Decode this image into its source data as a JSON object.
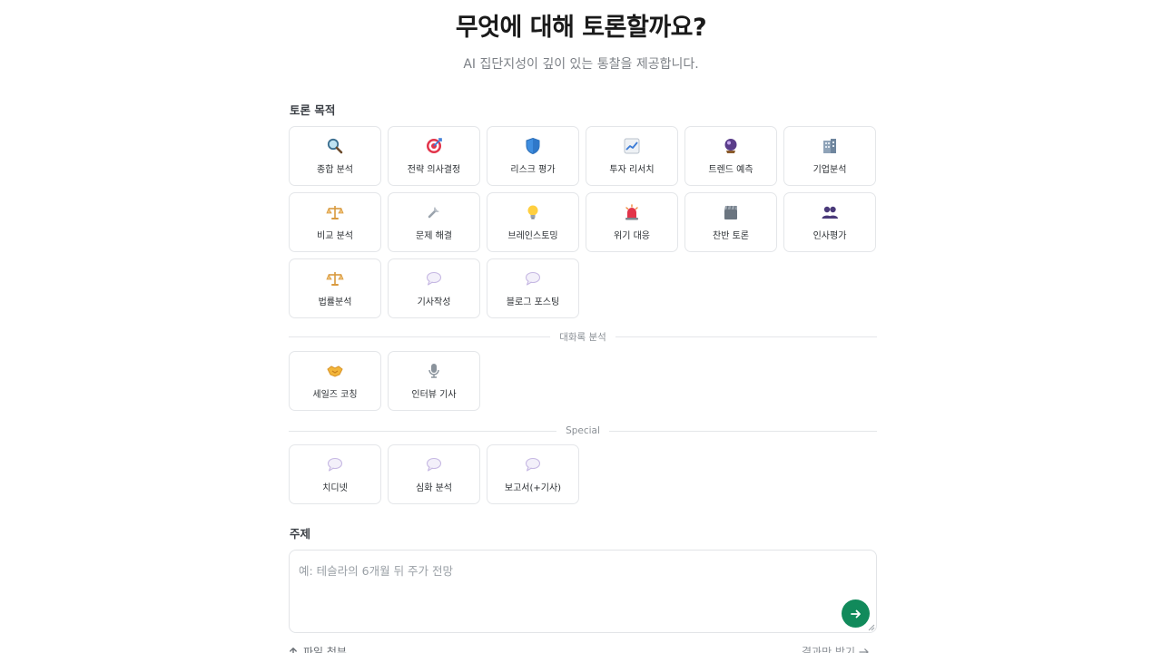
{
  "header": {
    "title": "무엇에 대해 토론할까요?",
    "subtitle": "AI 집단지성이 깊이 있는 통찰을 제공합니다."
  },
  "purpose_section": {
    "label": "토론 목적",
    "items": [
      {
        "label": "종합 분석",
        "icon": "magnifier-icon"
      },
      {
        "label": "전략 의사결정",
        "icon": "target-icon"
      },
      {
        "label": "리스크 평가",
        "icon": "shield-icon"
      },
      {
        "label": "투자 리서치",
        "icon": "chart-icon"
      },
      {
        "label": "트렌드 예측",
        "icon": "crystal-ball-icon"
      },
      {
        "label": "기업분석",
        "icon": "building-icon"
      },
      {
        "label": "비교 분석",
        "icon": "scale-icon"
      },
      {
        "label": "문제 해결",
        "icon": "wrench-icon"
      },
      {
        "label": "브레인스토밍",
        "icon": "lightbulb-icon"
      },
      {
        "label": "위기 대응",
        "icon": "siren-icon"
      },
      {
        "label": "찬반 토론",
        "icon": "clapperboard-icon"
      },
      {
        "label": "인사평가",
        "icon": "people-icon"
      },
      {
        "label": "법률분석",
        "icon": "scale-icon"
      },
      {
        "label": "기사작성",
        "icon": "speech-bubble-icon"
      },
      {
        "label": "블로그 포스팅",
        "icon": "speech-bubble-icon"
      }
    ]
  },
  "conversation_section": {
    "divider_label": "대화록 분석",
    "items": [
      {
        "label": "세일즈 코칭",
        "icon": "handshake-icon"
      },
      {
        "label": "인터뷰 기사",
        "icon": "microphone-icon"
      }
    ]
  },
  "special_section": {
    "divider_label": "Special",
    "items": [
      {
        "label": "치디넷",
        "icon": "speech-bubble-icon"
      },
      {
        "label": "심화 분석",
        "icon": "speech-bubble-icon"
      },
      {
        "label": "보고서(+기사)",
        "icon": "speech-bubble-icon"
      }
    ]
  },
  "topic": {
    "label": "주제",
    "placeholder": "예: 테슬라의 6개월 뒤 주가 전망",
    "value": "",
    "send_icon": "arrow-right-icon"
  },
  "footer": {
    "attach_label": "파일 첨부",
    "attach_icon": "upload-arrow-icon",
    "results_label": "결과만 받기",
    "results_icon": "arrow-right-icon"
  },
  "colors": {
    "accent": "#118a5b",
    "card_border": "#e4e6e9",
    "muted_text": "#7c8086"
  }
}
